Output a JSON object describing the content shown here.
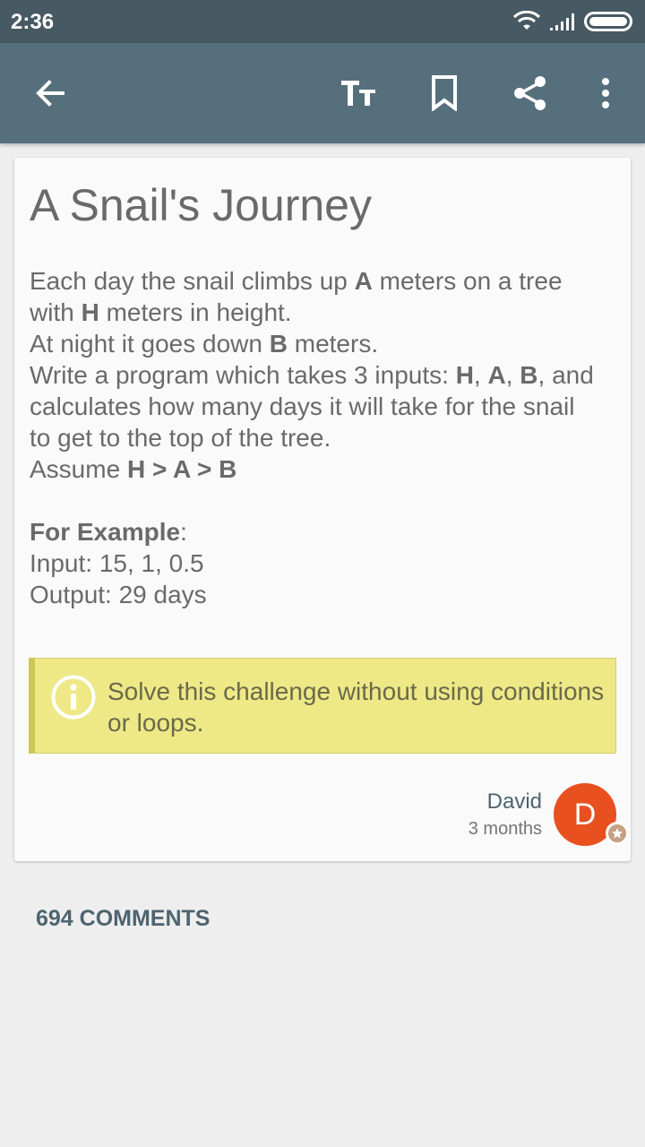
{
  "status_bar": {
    "time": "2:36",
    "icons": [
      "wifi-icon",
      "signal-icon",
      "battery-icon"
    ]
  },
  "app_bar": {
    "actions": [
      "back-arrow-icon",
      "text-size-icon",
      "bookmark-icon",
      "share-icon",
      "more-vert-icon"
    ],
    "text_size_glyph": "TT"
  },
  "challenge": {
    "title": "A Snail's Journey",
    "paragraphs": [
      [
        {
          "t": "Each day the snail climbs up "
        },
        {
          "t": "A",
          "b": true
        },
        {
          "t": " meters on a tree"
        }
      ],
      [
        {
          "t": "with "
        },
        {
          "t": "H",
          "b": true
        },
        {
          "t": " meters in height."
        }
      ],
      [
        {
          "t": "At night it goes down "
        },
        {
          "t": "B",
          "b": true
        },
        {
          "t": " meters."
        }
      ],
      [
        {
          "t": "Write a program which takes 3 inputs: "
        },
        {
          "t": "H",
          "b": true
        },
        {
          "t": ", "
        },
        {
          "t": "A",
          "b": true
        },
        {
          "t": ", "
        },
        {
          "t": "B",
          "b": true
        },
        {
          "t": ", and"
        }
      ],
      [
        {
          "t": "calculates how many days it will take for the snail"
        }
      ],
      [
        {
          "t": "to get to the top of the tree."
        }
      ],
      [
        {
          "t": "Assume "
        },
        {
          "t": "H > A > B",
          "b": true
        }
      ],
      [],
      [
        {
          "t": "For Example",
          "b": true
        },
        {
          "t": ":"
        }
      ],
      [
        {
          "t": "Input: 15, 1, 0.5"
        }
      ],
      [
        {
          "t": "Output: 29 days"
        }
      ]
    ],
    "note": "Solve this challenge without using conditions or loops."
  },
  "author": {
    "name": "David",
    "time": "3 months",
    "avatar_letter": "D",
    "avatar_color": "#e9501f",
    "badge_icon": "star-badge-icon"
  },
  "comments": {
    "label": "694 COMMENTS"
  },
  "colors": {
    "status_bar": "#475963",
    "app_bar": "#566f7d",
    "note_background": "#eee887",
    "note_border": "#cdc554",
    "body_text": "#6a6a6a",
    "accent_text": "#4e6470"
  }
}
